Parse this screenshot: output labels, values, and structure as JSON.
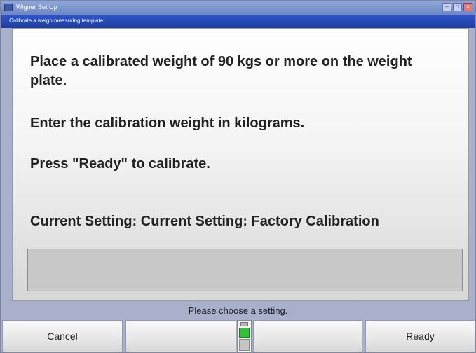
{
  "window": {
    "title": "Wigner Set Up",
    "subtitle": "Calibrate a weigh measuring template",
    "controls": [
      "minimize-icon",
      "maximize-icon",
      "close-icon"
    ]
  },
  "content": {
    "line1": "Place a calibrated weight of 90 kgs or more on the weight plate.",
    "line2": "Enter the calibration weight in kilograms.",
    "line3": "Press \"Ready\" to calibrate.",
    "current_setting": "Current Setting: Current Setting: Factory Calibration",
    "input_value": ""
  },
  "status": "Please choose a setting.",
  "buttons": {
    "cancel": "Cancel",
    "empty1": "",
    "empty2": "",
    "ready": "Ready"
  },
  "colors": {
    "subtitle_bar": "#2f56c5",
    "indicator_green": "#33c03a"
  }
}
